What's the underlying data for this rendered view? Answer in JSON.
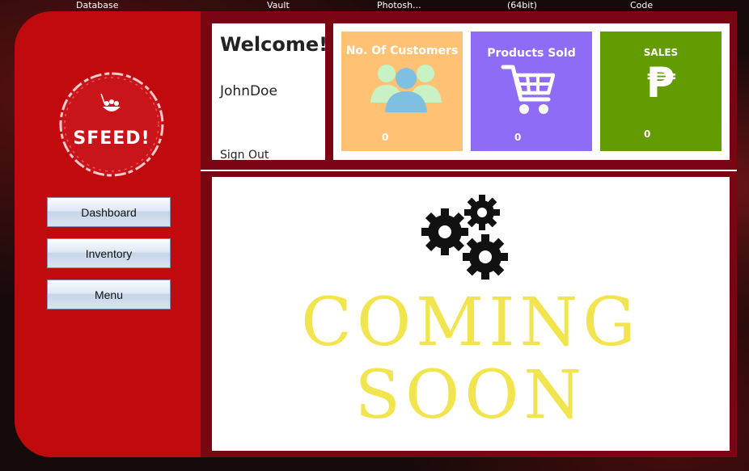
{
  "taskbar": {
    "items": [
      "Database",
      "Vault",
      "Photosh...",
      "(64bit)",
      "Code"
    ]
  },
  "logo": {
    "text": "SFEED!"
  },
  "nav": {
    "dashboard": "Dashboard",
    "inventory": "Inventory",
    "menu": "Menu"
  },
  "welcome": {
    "title": "Welcome!",
    "username": "JohnDoe",
    "signout": "Sign Out"
  },
  "stats": {
    "customers": {
      "label": "No. Of Customers",
      "value": "0",
      "color": "#ffc274"
    },
    "products": {
      "label": "Products Sold",
      "value": "0",
      "color": "#8f6cf6"
    },
    "sales": {
      "label": "SALES",
      "value": "0",
      "currency_symbol": "₱",
      "color": "#629c00"
    }
  },
  "main": {
    "line1": "COMING",
    "line2": "SOON"
  },
  "colors": {
    "sidebar": "#c00a0e",
    "frame": "#7a0614",
    "coming_soon": "#f2e44e"
  }
}
